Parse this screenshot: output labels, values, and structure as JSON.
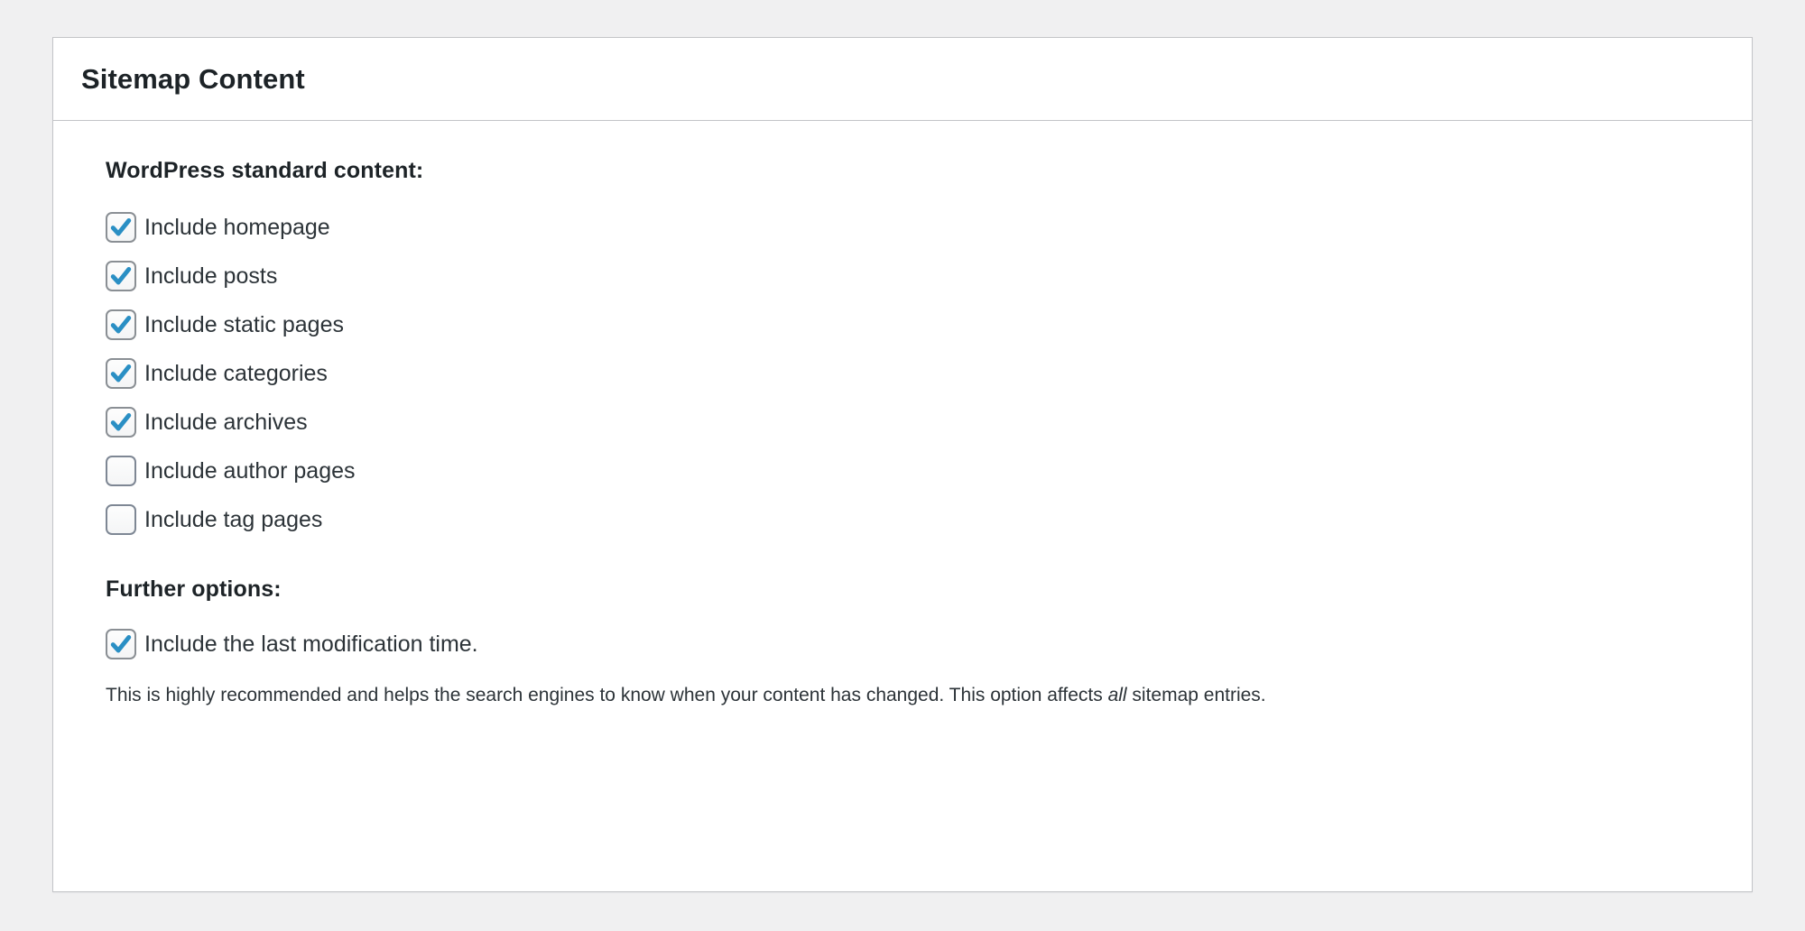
{
  "panel": {
    "title": "Sitemap Content"
  },
  "sections": [
    {
      "heading": "WordPress standard content:",
      "options": [
        {
          "label": "Include homepage",
          "checked": true
        },
        {
          "label": "Include posts",
          "checked": true
        },
        {
          "label": "Include static pages",
          "checked": true
        },
        {
          "label": "Include categories",
          "checked": true
        },
        {
          "label": "Include archives",
          "checked": true
        },
        {
          "label": "Include author pages",
          "checked": false
        },
        {
          "label": "Include tag pages",
          "checked": false
        }
      ]
    },
    {
      "heading": "Further options:",
      "options": [
        {
          "label": "Include the last modification time.",
          "checked": true
        }
      ]
    }
  ],
  "description": {
    "before": "This is highly recommended and helps the search engines to know when your content has changed. This option affects ",
    "emphasis": "all",
    "after": " sitemap entries."
  },
  "colors": {
    "page_background": "#f0f0f1",
    "panel_background": "#ffffff",
    "panel_border": "#c3c4c7",
    "title_text": "#1d2327",
    "body_text": "#2c3338",
    "checkmark_blue": "#2a8fc4",
    "checkbox_border": "#8a8f94"
  },
  "icons": {
    "checkmark": "checkmark-icon"
  }
}
